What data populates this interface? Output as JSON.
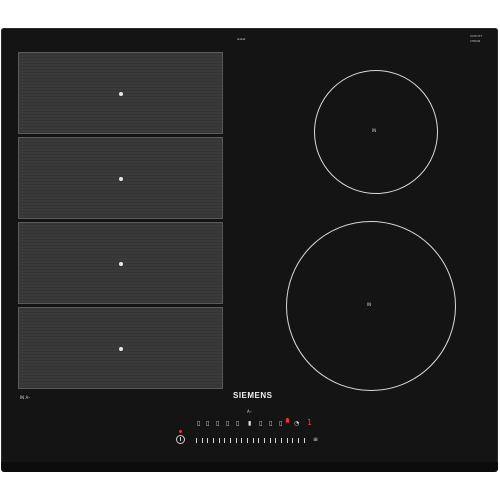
{
  "brand": {
    "logo_text": "SIEMENS"
  },
  "top_right_badge": {
    "line1": "SCHOTT",
    "line2": "CERAN"
  },
  "left_label": {
    "text": "IN  A–"
  },
  "control_panel": {
    "eco_label": "A–",
    "timer_digit": "1",
    "slider_labels": [
      "",
      "",
      "",
      ""
    ]
  },
  "cooking_zones": {
    "flex": [
      {
        "name": "flex-zone-1"
      },
      {
        "name": "flex-zone-2"
      },
      {
        "name": "flex-zone-3"
      },
      {
        "name": "flex-zone-4"
      }
    ],
    "round": [
      {
        "name": "small-round-zone",
        "mark": "IN"
      },
      {
        "name": "large-round-zone",
        "mark": "IN"
      }
    ]
  },
  "colors": {
    "glass": "#141414",
    "flex_zone": "#3a3a3a",
    "zone_outline": "#d9d9d9",
    "display_red": "#ff3030"
  }
}
